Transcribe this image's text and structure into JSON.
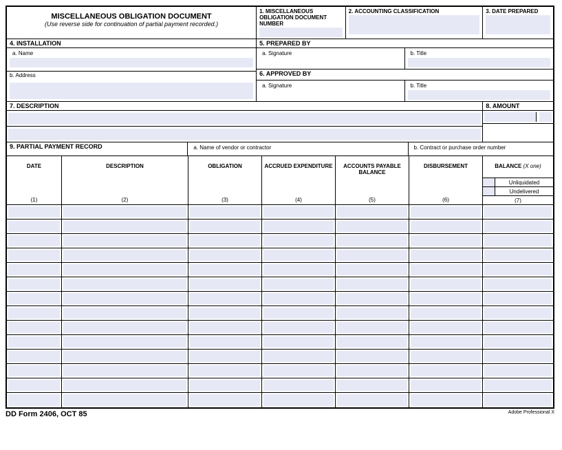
{
  "header": {
    "title": "MISCELLANEOUS OBLIGATION DOCUMENT",
    "subtitle": "(Use reverse side for continuation of partial payment recorded.)",
    "box1": "1. MISCELLANEOUS OBLIGATION DOCUMENT NUMBER",
    "box2": "2.   ACCOUNTING CLASSIFICATION",
    "box3": "3.  DATE PREPARED"
  },
  "section4": {
    "label": "4.  INSTALLATION",
    "a": "a.  Name",
    "b": "b.  Address"
  },
  "section5": {
    "label": "5.  PREPARED BY",
    "a": "a.  Signature",
    "b": "b.  Title"
  },
  "section6": {
    "label": "6.  APPROVED BY",
    "a": "a.  Signature",
    "b": "b.  Title"
  },
  "section7": {
    "label": "7.  DESCRIPTION"
  },
  "section8": {
    "label": "8.  AMOUNT"
  },
  "section9": {
    "label": "9.  PARTIAL PAYMENT RECORD",
    "a": "a.  Name of vendor or contractor",
    "b": "b.  Contract or purchase order number"
  },
  "columns": {
    "c1": {
      "name": "DATE",
      "num": "(1)"
    },
    "c2": {
      "name": "DESCRIPTION",
      "num": "(2)"
    },
    "c3": {
      "name": "OBLIGATION",
      "num": "(3)"
    },
    "c4": {
      "name": "ACCRUED EXPENDITURE",
      "num": "(4)"
    },
    "c5": {
      "name": "ACCOUNTS PAYABLE BALANCE",
      "num": "(5)"
    },
    "c6": {
      "name": "DISBURSEMENT",
      "num": "(6)"
    },
    "c7": {
      "name": "BALANCE",
      "hint": "(X one)",
      "opt1": "Unliquidated",
      "opt2": "Undelivered",
      "num": "(7)"
    }
  },
  "footer": {
    "left": "DD Form 2406, OCT 85",
    "right": "Adobe Professional X"
  }
}
